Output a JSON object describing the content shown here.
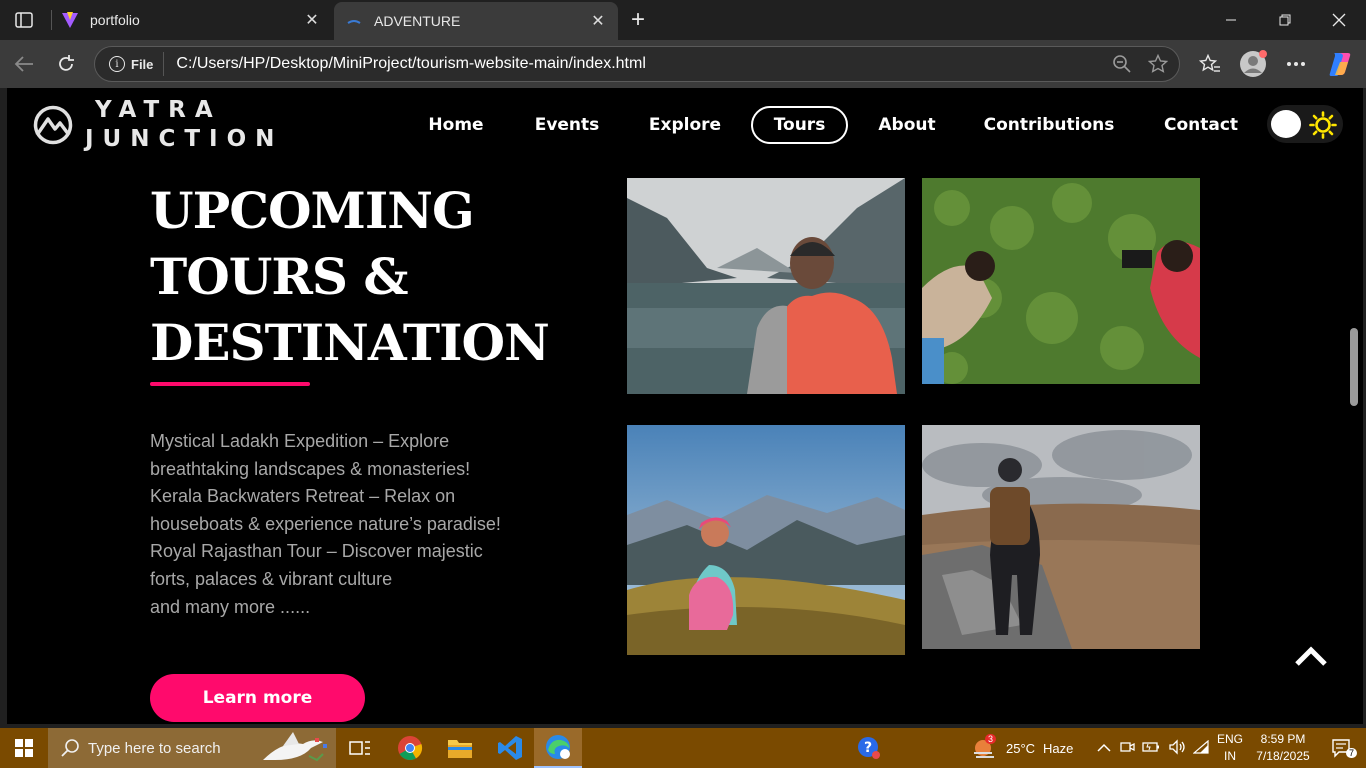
{
  "browser": {
    "tabs": [
      {
        "title": "portfolio",
        "active": false
      },
      {
        "title": "ADVENTURE",
        "active": true
      }
    ],
    "address": {
      "scheme_label": "File",
      "url": "C:/Users/HP/Desktop/MiniProject/tourism-website-main/index.html"
    }
  },
  "site": {
    "logo": {
      "line1": "YATRA",
      "line2": "JUNCTION"
    },
    "nav": [
      {
        "label": "Home",
        "active": false
      },
      {
        "label": "Events",
        "active": false
      },
      {
        "label": "Explore",
        "active": false
      },
      {
        "label": "Tours",
        "active": true
      },
      {
        "label": "About",
        "active": false
      },
      {
        "label": "Contributions",
        "active": false
      },
      {
        "label": "Contact",
        "active": false
      }
    ],
    "hero": {
      "title_lines": [
        "UPCOMING",
        "TOURS &",
        "DESTINATION"
      ],
      "description_lines": [
        "Mystical Ladakh Expedition – Explore",
        "breathtaking landscapes & monasteries!",
        "Kerala Backwaters Retreat – Relax on",
        "houseboats & experience nature’s paradise!",
        "Royal Rajasthan Tour – Discover majestic",
        "forts, palaces & vibrant culture",
        "and many more ......"
      ],
      "cta_label": "Learn more"
    },
    "colors": {
      "accent": "#ff0a6c",
      "background": "#000000",
      "sun": "#ffe600"
    }
  },
  "taskbar": {
    "search_placeholder": "Type here to search",
    "weather": {
      "temp": "25°C",
      "condition": "Haze",
      "badge": "3"
    },
    "language": {
      "line1": "ENG",
      "line2": "IN"
    },
    "clock": {
      "time": "8:59 PM",
      "date": "7/18/2025"
    },
    "notifications_count": "7"
  }
}
